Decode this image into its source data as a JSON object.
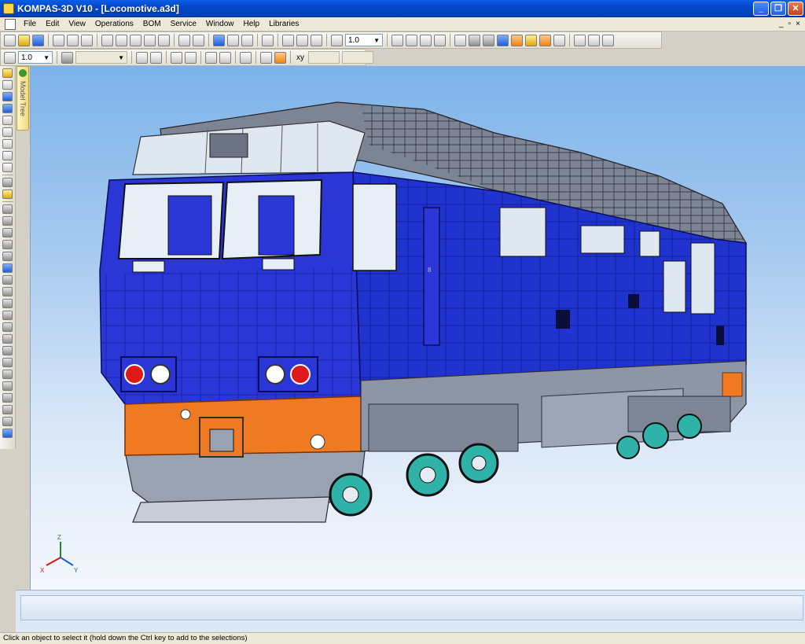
{
  "window": {
    "title": "KOMPAS-3D V10 - [Locomotive.a3d]",
    "minimize_glyph": "_",
    "maximize_glyph": "❐",
    "close_glyph": "✕"
  },
  "menubar": {
    "items": [
      "File",
      "Edit",
      "View",
      "Operations",
      "BOM",
      "Service",
      "Window",
      "Help",
      "Libraries"
    ],
    "mdi_controls": [
      "_",
      "▫",
      "×"
    ]
  },
  "toolbar1": {
    "zoom_value": "1.0"
  },
  "toolbar2": {
    "step_value": "1.0",
    "xy_label": "xy"
  },
  "model_tree": {
    "label": "Model Tree"
  },
  "viewport": {
    "axes": {
      "x": "X",
      "y": "Y",
      "z": "Z"
    },
    "colors": {
      "body": "#1f2fd0",
      "skirt": "#f07a22",
      "frame": "#8e96a6",
      "wheels": "#2fb3a8",
      "lamp_red": "#e11818",
      "lamp_white": "#ffffff"
    },
    "dial_label": "8"
  },
  "status": {
    "text": "Click an object to select it (hold down the Ctrl key to add to the selections)"
  }
}
